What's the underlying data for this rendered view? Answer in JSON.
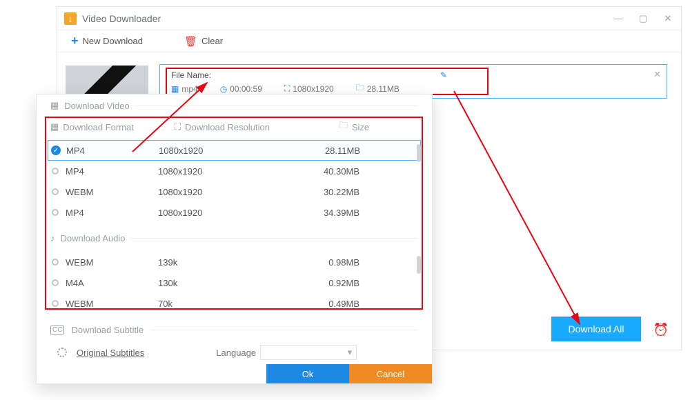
{
  "window": {
    "title": "Video Downloader",
    "toolbar": {
      "new_download": "New Download",
      "clear": "Clear"
    }
  },
  "item": {
    "filename_label": "File Name:",
    "filename_value": "",
    "format": "mp4",
    "duration": "00:00:59",
    "resolution": "1080x1920",
    "size": "28.11MB"
  },
  "download_all": "Download All",
  "dialog": {
    "section_video": "Download Video",
    "section_audio": "Download Audio",
    "section_subtitle": "Download Subtitle",
    "columns": {
      "format": "Download Format",
      "resolution": "Download Resolution",
      "size": "Size"
    },
    "video_rows": [
      {
        "format": "MP4",
        "resolution": "1080x1920",
        "size": "28.11MB",
        "selected": true
      },
      {
        "format": "MP4",
        "resolution": "1080x1920",
        "size": "40.30MB",
        "selected": false
      },
      {
        "format": "WEBM",
        "resolution": "1080x1920",
        "size": "30.22MB",
        "selected": false
      },
      {
        "format": "MP4",
        "resolution": "1080x1920",
        "size": "34.39MB",
        "selected": false
      }
    ],
    "audio_rows": [
      {
        "format": "WEBM",
        "resolution": "139k",
        "size": "0.98MB"
      },
      {
        "format": "M4A",
        "resolution": "130k",
        "size": "0.92MB"
      },
      {
        "format": "WEBM",
        "resolution": "70k",
        "size": "0.49MB"
      }
    ],
    "subtitle": {
      "original": "Original Subtitles",
      "language_label": "Language"
    },
    "buttons": {
      "ok": "Ok",
      "cancel": "Cancel"
    }
  }
}
